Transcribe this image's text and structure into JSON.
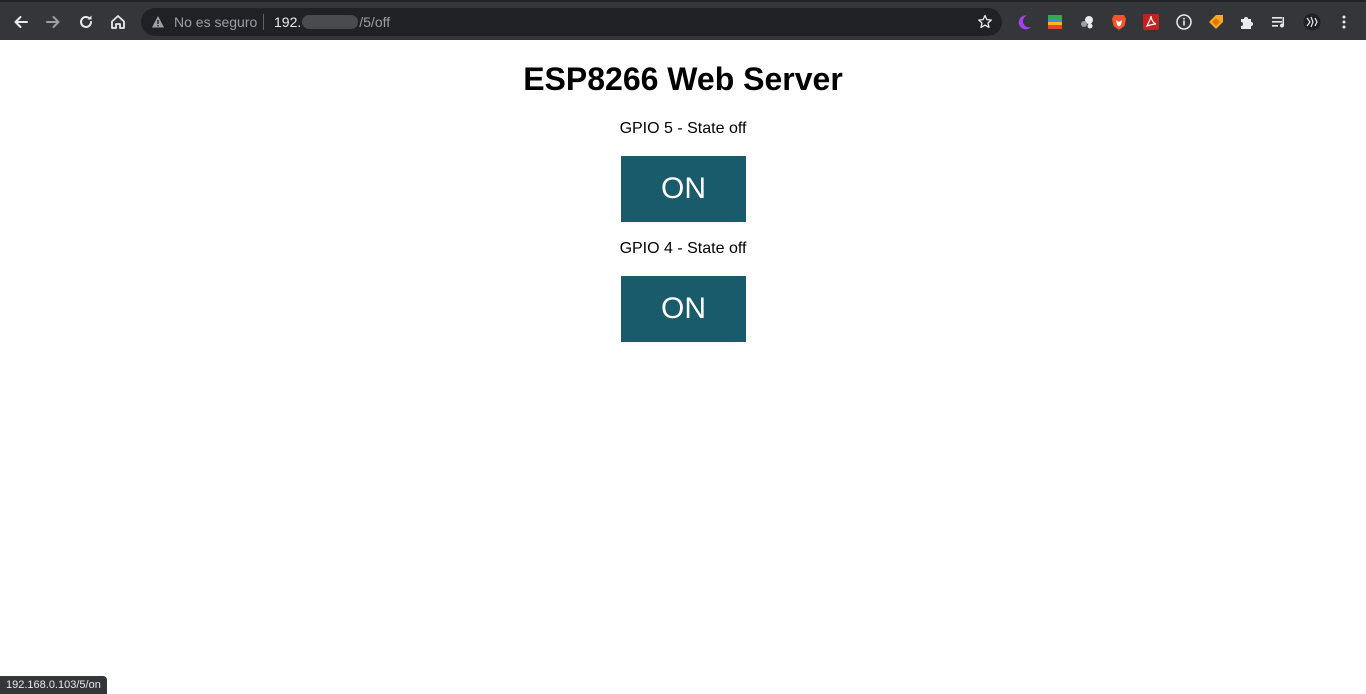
{
  "browser": {
    "security_label": "No es seguro",
    "url_host": "192.",
    "url_path": "/5/off",
    "status_url": "192.168.0.103/5/on",
    "toolbar_color": "#35363a",
    "icons": {
      "back": "back-arrow-icon",
      "forward": "forward-arrow-icon",
      "reload": "reload-icon",
      "home": "home-icon",
      "warning": "warning-icon",
      "bookmark": "star-icon",
      "extensions": [
        "dark-mode-moon-icon",
        "color-stack-icon",
        "dots-icon",
        "brave-lion-icon",
        "pdf-icon",
        "info-circle-icon",
        "tag-icon",
        "puzzle-icon",
        "media-queue-icon",
        "profile-avatar-icon",
        "menu-kebab-icon"
      ]
    }
  },
  "page": {
    "title": "ESP8266 Web Server",
    "button_color": "#195b6a",
    "gpios": [
      {
        "label": "GPIO 5 - State off",
        "button_label": "ON"
      },
      {
        "label": "GPIO 4 - State off",
        "button_label": "ON"
      }
    ]
  }
}
